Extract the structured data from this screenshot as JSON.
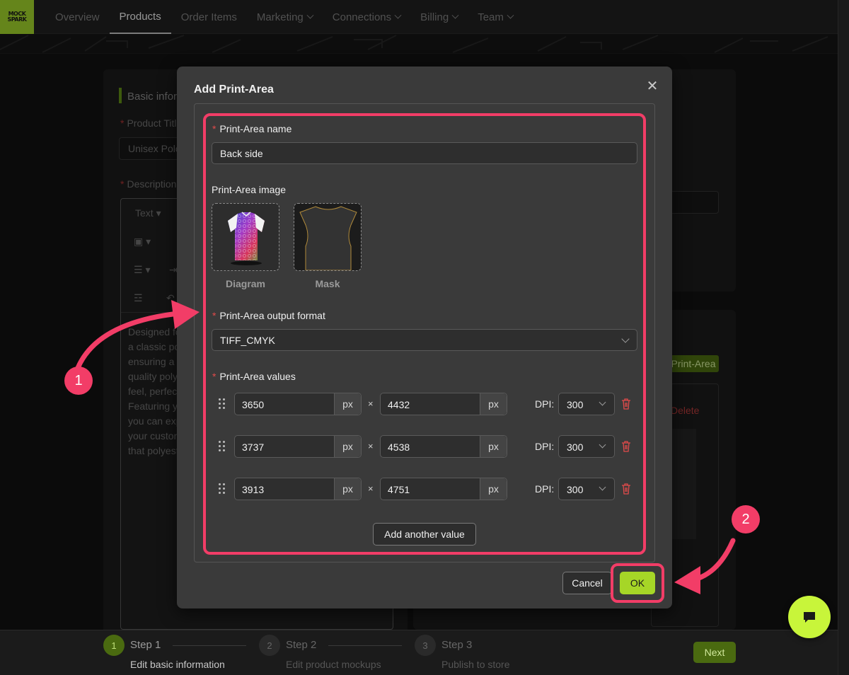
{
  "app": {
    "logo_lines": [
      "MOCK",
      "SPARK"
    ],
    "nav": [
      {
        "label": "Overview",
        "dropdown": false,
        "active": false
      },
      {
        "label": "Products",
        "dropdown": false,
        "active": true
      },
      {
        "label": "Order Items",
        "dropdown": false,
        "active": false
      },
      {
        "label": "Marketing",
        "dropdown": true,
        "active": false
      },
      {
        "label": "Connections",
        "dropdown": true,
        "active": false
      },
      {
        "label": "Billing",
        "dropdown": true,
        "active": false
      },
      {
        "label": "Team",
        "dropdown": true,
        "active": false
      }
    ]
  },
  "background": {
    "section_title": "Basic infor",
    "product_title_label": "Product Titl",
    "product_title_value": "Unisex Polo",
    "description_label": "Description",
    "editor_text_style": "Text",
    "description_lines": [
      "Designed fo",
      "a classic po",
      "ensuring a",
      "quality poly",
      "feel, perfect",
      "Featuring y",
      "you can exp",
      "your custon",
      "that polyest"
    ],
    "print_area_tag": "Print-Area",
    "delete_link": "Delete"
  },
  "modal": {
    "title": "Add Print-Area",
    "name_label": "Print-Area name",
    "name_value": "Back side",
    "image_label": "Print-Area image",
    "diagram_caption": "Diagram",
    "mask_caption": "Mask",
    "format_label": "Print-Area output format",
    "format_value": "TIFF_CMYK",
    "values_label": "Print-Area values",
    "unit": "px",
    "times": "×",
    "dpi_label": "DPI:",
    "rows": [
      {
        "width": "3650",
        "height": "4432",
        "dpi": "300"
      },
      {
        "width": "3737",
        "height": "4538",
        "dpi": "300"
      },
      {
        "width": "3913",
        "height": "4751",
        "dpi": "300"
      }
    ],
    "add_value_button": "Add another value",
    "cancel_button": "Cancel",
    "ok_button": "OK"
  },
  "annotations": {
    "badge1": "1",
    "badge2": "2",
    "accent_color": "#f23d67"
  },
  "stepper": {
    "steps": [
      {
        "num": "1",
        "title": "Step 1",
        "sub": "Edit basic information",
        "active": true
      },
      {
        "num": "2",
        "title": "Step 2",
        "sub": "Edit product mockups",
        "active": false
      },
      {
        "num": "3",
        "title": "Step 3",
        "sub": "Publish to store",
        "active": false
      }
    ],
    "next_button": "Next"
  },
  "icons": [
    "close-icon",
    "chevron-down-icon",
    "drag-handle-icon",
    "trash-icon",
    "chat-icon"
  ],
  "colors": {
    "brand": "#a6d627",
    "danger": "#e24b4b"
  }
}
